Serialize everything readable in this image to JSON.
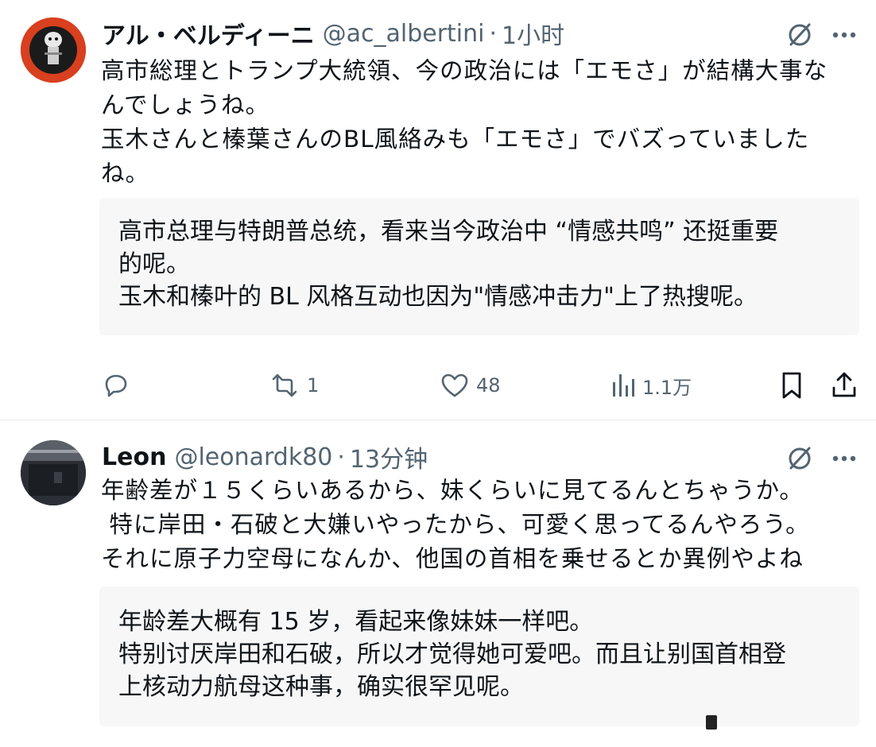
{
  "tweets": [
    {
      "display_name": "アル・ベルディーニ",
      "handle": "@ac_albertini",
      "separator": "·",
      "time": "1小时",
      "text_lines": [
        "高市総理とトランプ大統領、今の政治には「エモさ」が結構大事な",
        "んでしょうね。",
        "玉木さんと榛葉さんのBL風絡みも「エモさ」でバズっていました",
        "ね。"
      ],
      "translation_lines": [
        "高市总理与特朗普总统，看来当今政治中 “情感共鸣” 还挺重要",
        "的呢。",
        "玉木和榛叶的 BL 风格互动也因为\"情感冲击力\"上了热搜呢。"
      ],
      "actions": {
        "reply_count": "",
        "retweet_count": "1",
        "like_count": "48",
        "views_count": "1.1万"
      },
      "avatar_icon": "avatar-image",
      "avatar_color": "#d8401f"
    },
    {
      "display_name": "Leon",
      "handle": "@leonardk80",
      "separator": "·",
      "time": "13分钟",
      "text_lines": [
        "年齢差が１５くらいあるから、妹くらいに見てるんとちゃうか。",
        " 特に岸田・石破と大嫌いやったから、可愛く思ってるんやろう。",
        "それに原子力空母になんか、他国の首相を乗せるとか異例やよね"
      ],
      "translation_lines": [
        "年龄差大概有 15 岁，看起来像妹妹一样吧。",
        "特别讨厌岸田和石破，所以才觉得她可爱吧。而且让别国首相登",
        "上核动力航母这种事，确实很罕见呢。"
      ],
      "avatar_icon": "avatar-image",
      "avatar_color": "#2b2f35"
    }
  ],
  "icons": {
    "grok": "grok-icon",
    "more": "more-icon",
    "reply": "reply-icon",
    "retweet": "retweet-icon",
    "like": "heart-icon",
    "views": "views-icon",
    "bookmark": "bookmark-icon",
    "share": "share-icon"
  },
  "colors": {
    "text": "#0f1419",
    "secondary": "#536471",
    "translation_bg": "#f7f7f7"
  }
}
